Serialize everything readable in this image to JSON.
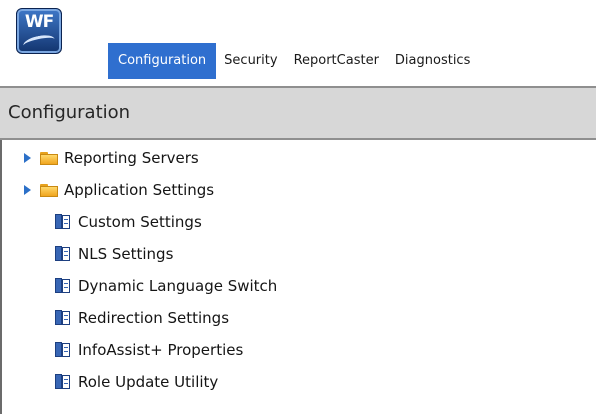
{
  "app": {
    "logo_text": "WF"
  },
  "tabs": [
    {
      "label": "Configuration",
      "active": true
    },
    {
      "label": "Security",
      "active": false
    },
    {
      "label": "ReportCaster",
      "active": false
    },
    {
      "label": "Diagnostics",
      "active": false
    }
  ],
  "panel": {
    "title": "Configuration"
  },
  "tree": {
    "folders": [
      {
        "label": "Reporting Servers",
        "icon": "folder-icon",
        "expandable": true
      },
      {
        "label": "Application Settings",
        "icon": "folder-icon",
        "expandable": true
      }
    ],
    "items": [
      {
        "label": "Custom Settings",
        "icon": "settings-doc-icon"
      },
      {
        "label": "NLS Settings",
        "icon": "settings-doc-icon"
      },
      {
        "label": "Dynamic Language Switch",
        "icon": "settings-doc-icon"
      },
      {
        "label": "Redirection Settings",
        "icon": "settings-doc-icon"
      },
      {
        "label": "InfoAssist+ Properties",
        "icon": "settings-doc-icon"
      },
      {
        "label": "Role Update Utility",
        "icon": "settings-doc-icon"
      }
    ]
  },
  "colors": {
    "active_tab": "#2f6fcf",
    "title_bar": "#d7d7d7",
    "folder": "#f0a51f",
    "arrow": "#2c70c8"
  }
}
